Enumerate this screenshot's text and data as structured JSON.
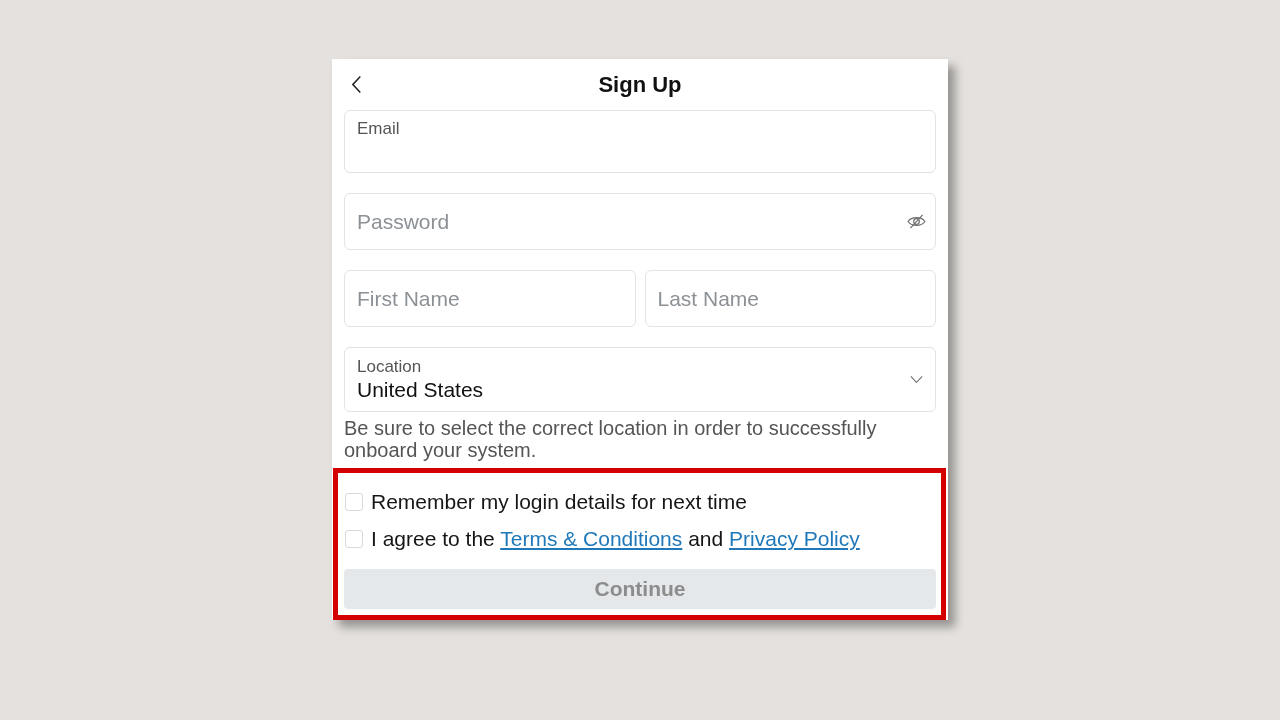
{
  "header": {
    "title": "Sign Up"
  },
  "email": {
    "label": "Email"
  },
  "password": {
    "placeholder": "Password"
  },
  "name_fields": [
    {
      "placeholder": "First Name"
    },
    {
      "placeholder": "Last Name"
    }
  ],
  "location": {
    "label": "Location",
    "value": "United States"
  },
  "location_hint": "Be sure to select the correct location in order to successfully onboard your system.",
  "consent": {
    "highlighted": true,
    "options": [
      {
        "checked": false,
        "segments": [
          {
            "kind": "text",
            "text": "Remember my login details for next time"
          }
        ]
      },
      {
        "checked": false,
        "segments": [
          {
            "kind": "text",
            "text": "I agree to the"
          },
          {
            "kind": "link",
            "text": "Terms & Conditions"
          },
          {
            "kind": "text",
            "text": "and"
          },
          {
            "kind": "link",
            "text": "Privacy Policy"
          }
        ]
      }
    ]
  },
  "continue_button": {
    "label": "Continue",
    "disabled": true
  }
}
